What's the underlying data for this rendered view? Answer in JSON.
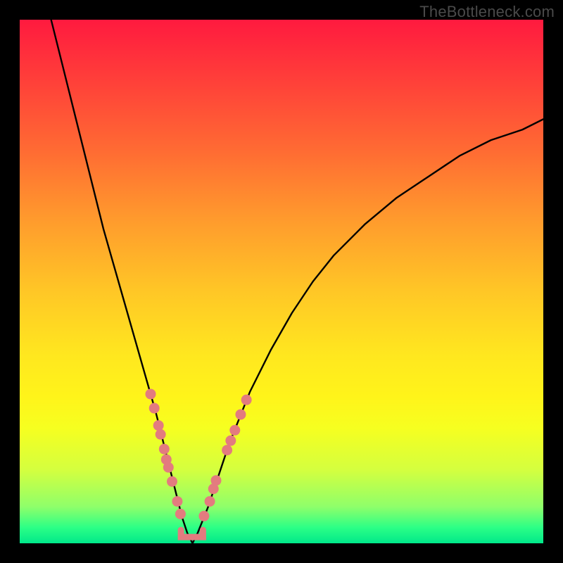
{
  "watermark": "TheBottleneck.com",
  "chart_data": {
    "type": "line",
    "title": "",
    "xlabel": "",
    "ylabel": "",
    "xlim": [
      0,
      100
    ],
    "ylim": [
      0,
      100
    ],
    "curve": {
      "name": "bottleneck-curve",
      "x": [
        6,
        8,
        10,
        12,
        14,
        16,
        18,
        20,
        22,
        24,
        26,
        27,
        28,
        29,
        30,
        31,
        32,
        33,
        34,
        36,
        38,
        40,
        44,
        48,
        52,
        56,
        60,
        66,
        72,
        78,
        84,
        90,
        96,
        100
      ],
      "y": [
        100,
        92,
        84,
        76,
        68,
        60,
        53,
        46,
        39,
        32,
        25,
        21,
        17,
        13,
        9,
        5,
        2,
        0,
        2,
        7,
        13,
        19,
        29,
        37,
        44,
        50,
        55,
        61,
        66,
        70,
        74,
        77,
        79,
        81
      ]
    },
    "markers_left": {
      "name": "left-dots",
      "color": "#e37b7f",
      "points": [
        {
          "x": 25.0,
          "y": 28.5
        },
        {
          "x": 25.7,
          "y": 25.8
        },
        {
          "x": 26.5,
          "y": 22.5
        },
        {
          "x": 26.9,
          "y": 20.8
        },
        {
          "x": 27.6,
          "y": 18.0
        },
        {
          "x": 28.0,
          "y": 16.0
        },
        {
          "x": 28.4,
          "y": 14.5
        },
        {
          "x": 29.1,
          "y": 11.8
        },
        {
          "x": 30.1,
          "y": 8.0
        },
        {
          "x": 30.7,
          "y": 5.6
        }
      ]
    },
    "markers_right": {
      "name": "right-dots",
      "color": "#e37b7f",
      "points": [
        {
          "x": 35.2,
          "y": 5.2
        },
        {
          "x": 36.3,
          "y": 8.0
        },
        {
          "x": 37.0,
          "y": 10.4
        },
        {
          "x": 37.5,
          "y": 12.0
        },
        {
          "x": 39.6,
          "y": 17.8
        },
        {
          "x": 40.3,
          "y": 19.6
        },
        {
          "x": 41.1,
          "y": 21.6
        },
        {
          "x": 42.2,
          "y": 24.6
        },
        {
          "x": 43.3,
          "y": 27.4
        }
      ]
    },
    "bottom_bracket": {
      "name": "bottom-bracket",
      "color": "#e37b7f",
      "x0": 30.8,
      "x1": 35.0,
      "y": 1.2
    }
  }
}
